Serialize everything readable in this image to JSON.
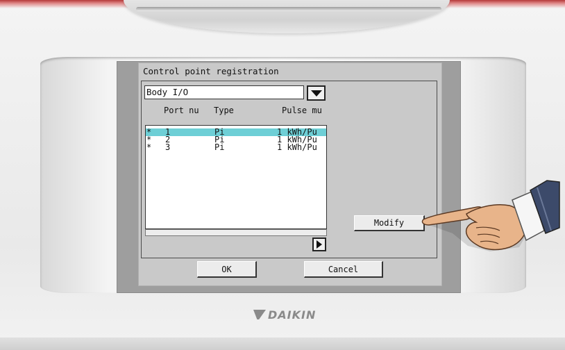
{
  "window": {
    "title": "Control point registration"
  },
  "io_select": {
    "value": "Body I/O",
    "dropdown_icon": "chevron-down-icon"
  },
  "table": {
    "columns": [
      "Port nu",
      "Type",
      "Pulse mu"
    ],
    "rows": [
      {
        "mark": "*",
        "port": "1",
        "type": "Pi",
        "pulse": "1 kWh/Pu",
        "selected": true
      },
      {
        "mark": "*",
        "port": "2",
        "type": "Pi",
        "pulse": "1 kWh/Pu",
        "selected": false
      },
      {
        "mark": "*",
        "port": "3",
        "type": "Pi",
        "pulse": "1 kWh/Pu",
        "selected": false
      }
    ],
    "scroll_icon": "arrow-right-icon"
  },
  "buttons": {
    "modify": "Modify",
    "ok": "OK",
    "cancel": "Cancel"
  },
  "device": {
    "brand": "DAIKIN"
  },
  "colors": {
    "selection": "#6ecfd6",
    "screen_bg": "#c9c9c9"
  }
}
